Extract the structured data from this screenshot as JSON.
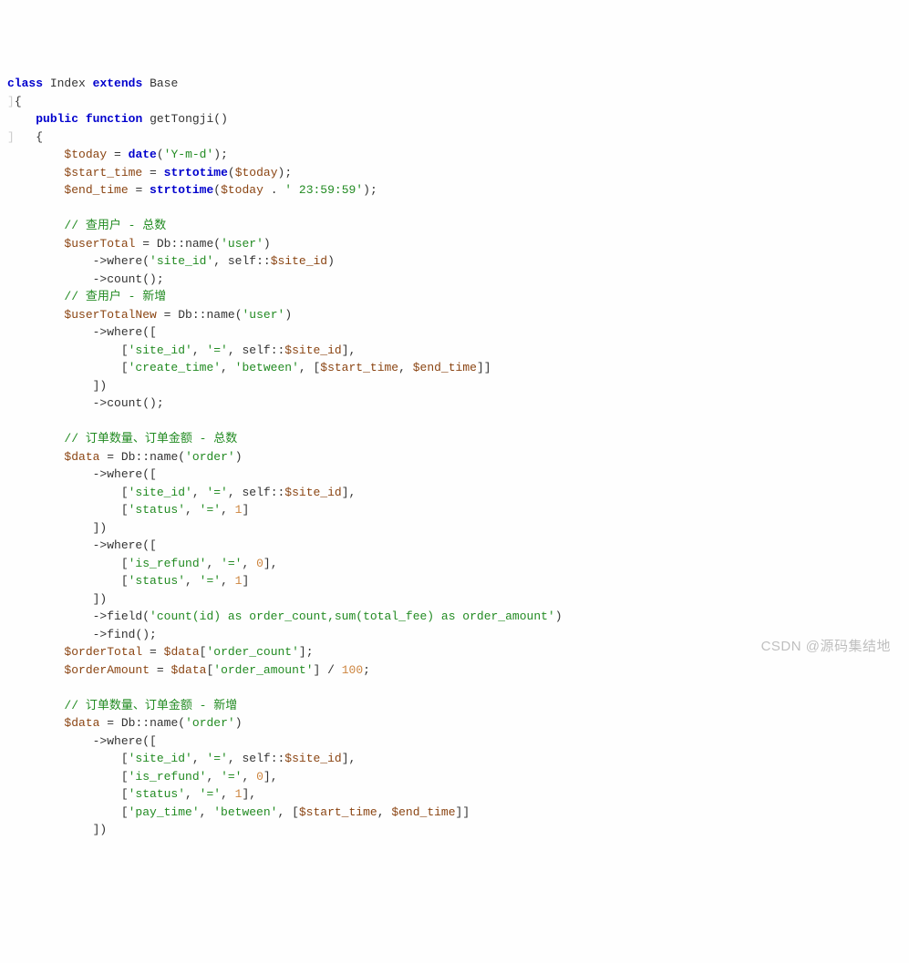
{
  "code": {
    "l01_class": "class",
    "l01_name": "Index",
    "l01_extends": "extends",
    "l01_base": "Base",
    "l02_brace": "{",
    "l03_public": "public",
    "l03_function": "function",
    "l03_fn": "getTongji",
    "l03_paren": "()",
    "l04_brace": "{",
    "l05_var": "$today",
    "l05_eq": " = ",
    "l05_fn": "date",
    "l05_arg": "'Y-m-d'",
    "l05_end": ";",
    "l06_var": "$start_time",
    "l06_eq": " = ",
    "l06_fn": "strtotime",
    "l06_arg": "$today",
    "l06_end": ";",
    "l07_var": "$end_time",
    "l07_eq": " = ",
    "l07_fn": "strtotime",
    "l07_arg1": "$today",
    "l07_cat": " . ",
    "l07_arg2": "' 23:59:59'",
    "l07_end": ";",
    "c1": "// 查用户 - 总数",
    "l09_var": "$userTotal",
    "l09_eq": " = ",
    "l09_db": "Db",
    "l09_cc": "::",
    "l09_name": "name",
    "l09_arg": "'user'",
    "l10_where": "where",
    "l10_a1": "'site_id'",
    "l10_self": "self",
    "l10_cc": "::",
    "l10_prop": "$site_id",
    "l11_count": "count",
    "c2": "// 查用户 - 新增",
    "l13_var": "$userTotalNew",
    "l13_eq": " = ",
    "l13_db": "Db",
    "l13_cc": "::",
    "l13_name": "name",
    "l13_arg": "'user'",
    "l14_where": "where",
    "l15_s1": "'site_id'",
    "l15_s2": "'='",
    "l15_self": "self",
    "l15_cc": "::",
    "l15_prop": "$site_id",
    "l16_s1": "'create_time'",
    "l16_s2": "'between'",
    "l16_v1": "$start_time",
    "l16_v2": "$end_time",
    "l18_count": "count",
    "c3": "// 订单数量、订单金额 - 总数",
    "l20_var": "$data",
    "l20_eq": " = ",
    "l20_db": "Db",
    "l20_cc": "::",
    "l20_name": "name",
    "l20_arg": "'order'",
    "l21_where": "where",
    "l22_s1": "'site_id'",
    "l22_s2": "'='",
    "l22_self": "self",
    "l22_cc": "::",
    "l22_prop": "$site_id",
    "l23_s1": "'status'",
    "l23_s2": "'='",
    "l23_n": "1",
    "l25_where": "where",
    "l26_s1": "'is_refund'",
    "l26_s2": "'='",
    "l26_n": "0",
    "l27_s1": "'status'",
    "l27_s2": "'='",
    "l27_n": "1",
    "l29_field": "field",
    "l29_arg": "'count(id) as order_count,sum(total_fee) as order_amount'",
    "l30_find": "find",
    "l31_var": "$orderTotal",
    "l31_eq": " = ",
    "l31_data": "$data",
    "l31_key": "'order_count'",
    "l32_var": "$orderAmount",
    "l32_eq": " = ",
    "l32_data": "$data",
    "l32_key": "'order_amount'",
    "l32_div": " / ",
    "l32_n": "100",
    "c4": "// 订单数量、订单金额 - 新增",
    "l34_var": "$data",
    "l34_eq": " = ",
    "l34_db": "Db",
    "l34_cc": "::",
    "l34_name": "name",
    "l34_arg": "'order'",
    "l35_where": "where",
    "l36_s1": "'site_id'",
    "l36_s2": "'='",
    "l36_self": "self",
    "l36_cc": "::",
    "l36_prop": "$site_id",
    "l37_s1": "'is_refund'",
    "l37_s2": "'='",
    "l37_n": "0",
    "l38_s1": "'status'",
    "l38_s2": "'='",
    "l38_n": "1",
    "l39_s1": "'pay_time'",
    "l39_s2": "'between'",
    "l39_v1": "$start_time",
    "l39_v2": "$end_time"
  },
  "watermark": "CSDN @源码集结地"
}
